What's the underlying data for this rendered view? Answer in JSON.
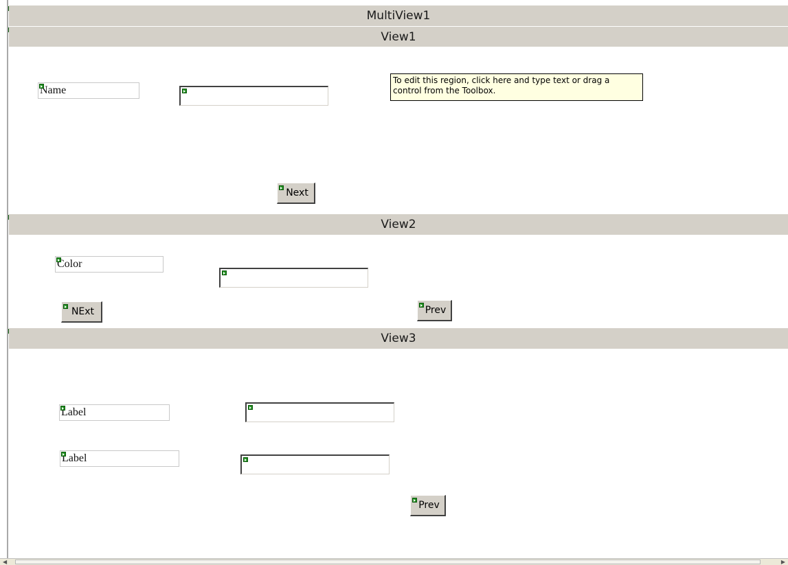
{
  "multiview": {
    "title": "MultiView1"
  },
  "tooltip": {
    "text": "To edit this region, click here and type text or drag a control from the Toolbox."
  },
  "view1": {
    "title": "View1",
    "label": "Name",
    "textbox_value": "",
    "next_button": "Next"
  },
  "view2": {
    "title": "View2",
    "label": "Color",
    "textbox_value": "",
    "next_button": "NExt",
    "prev_button": "Prev"
  },
  "view3": {
    "title": "View3",
    "label1": "Label",
    "label2": "Label",
    "textbox1_value": "",
    "textbox2_value": "",
    "prev_button": "Prev"
  },
  "icons": {
    "control_glyph": "control-marker-icon",
    "scroll_left": "scroll-left-icon",
    "scroll_right": "scroll-right-icon"
  },
  "colors": {
    "bar_background": "#d4d0c8",
    "tooltip_background": "#ffffe1",
    "control_marker": "#1f8f1f"
  }
}
